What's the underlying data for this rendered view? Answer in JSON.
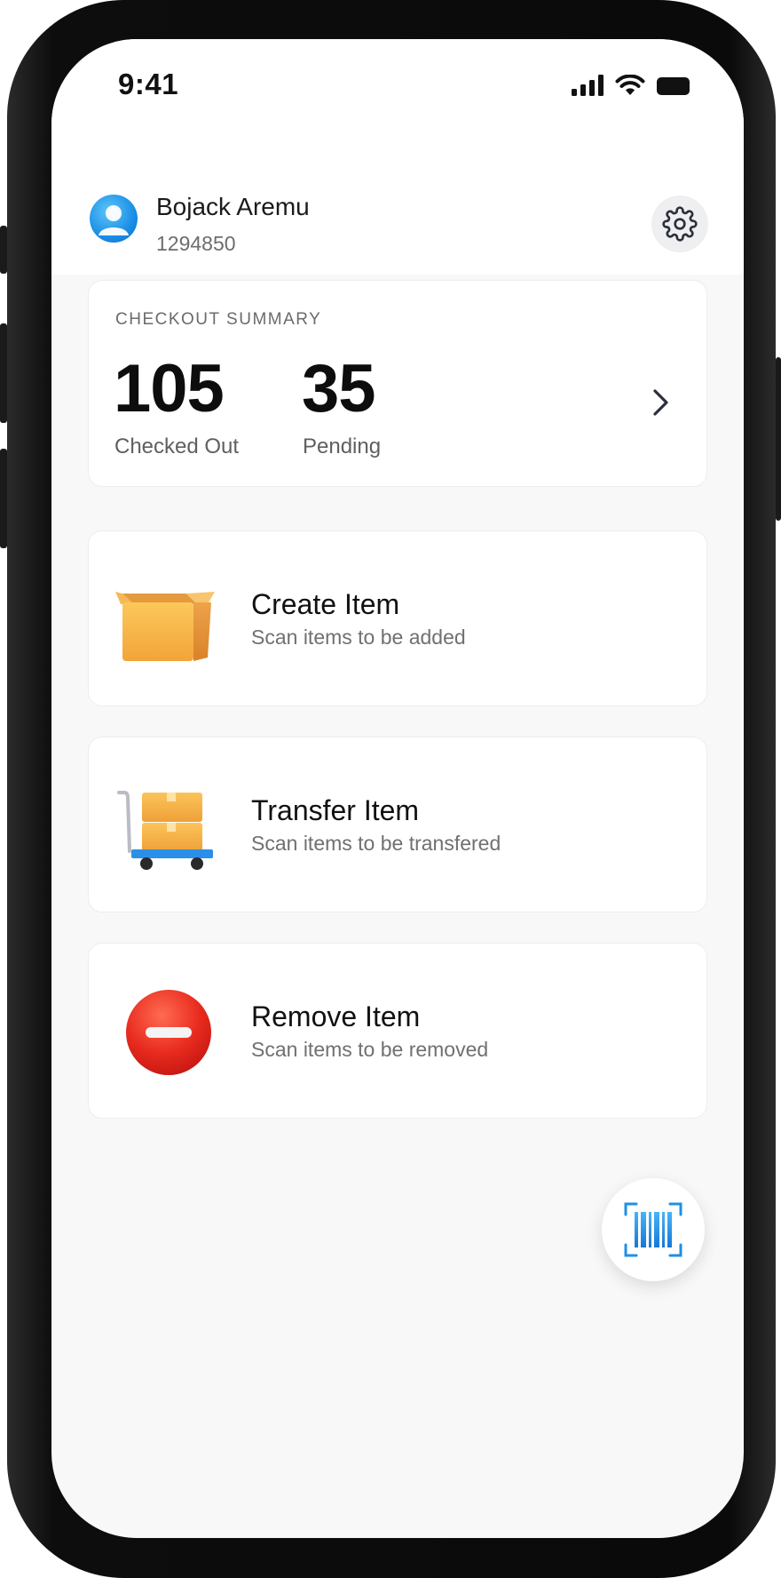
{
  "status_bar": {
    "time": "9:41"
  },
  "header": {
    "user_name": "Bojack Aremu",
    "user_id": "1294850",
    "settings_icon": "gear-icon"
  },
  "summary": {
    "label": "CHECKOUT SUMMARY",
    "checked_out_value": "105",
    "checked_out_label": "Checked Out",
    "pending_value": "35",
    "pending_label": "Pending"
  },
  "actions": [
    {
      "title": "Create Item",
      "subtitle": "Scan items to be added",
      "icon": "box-icon"
    },
    {
      "title": "Transfer Item",
      "subtitle": "Scan items to be transfered",
      "icon": "cart-icon"
    },
    {
      "title": "Remove Item",
      "subtitle": "Scan items to be removed",
      "icon": "remove-icon"
    }
  ],
  "fab": {
    "icon": "barcode-scan-icon"
  },
  "colors": {
    "background": "#f8f8f8",
    "card": "#ffffff",
    "remove_red": "#e52620",
    "scanner_blue": "#1f8fe6"
  }
}
